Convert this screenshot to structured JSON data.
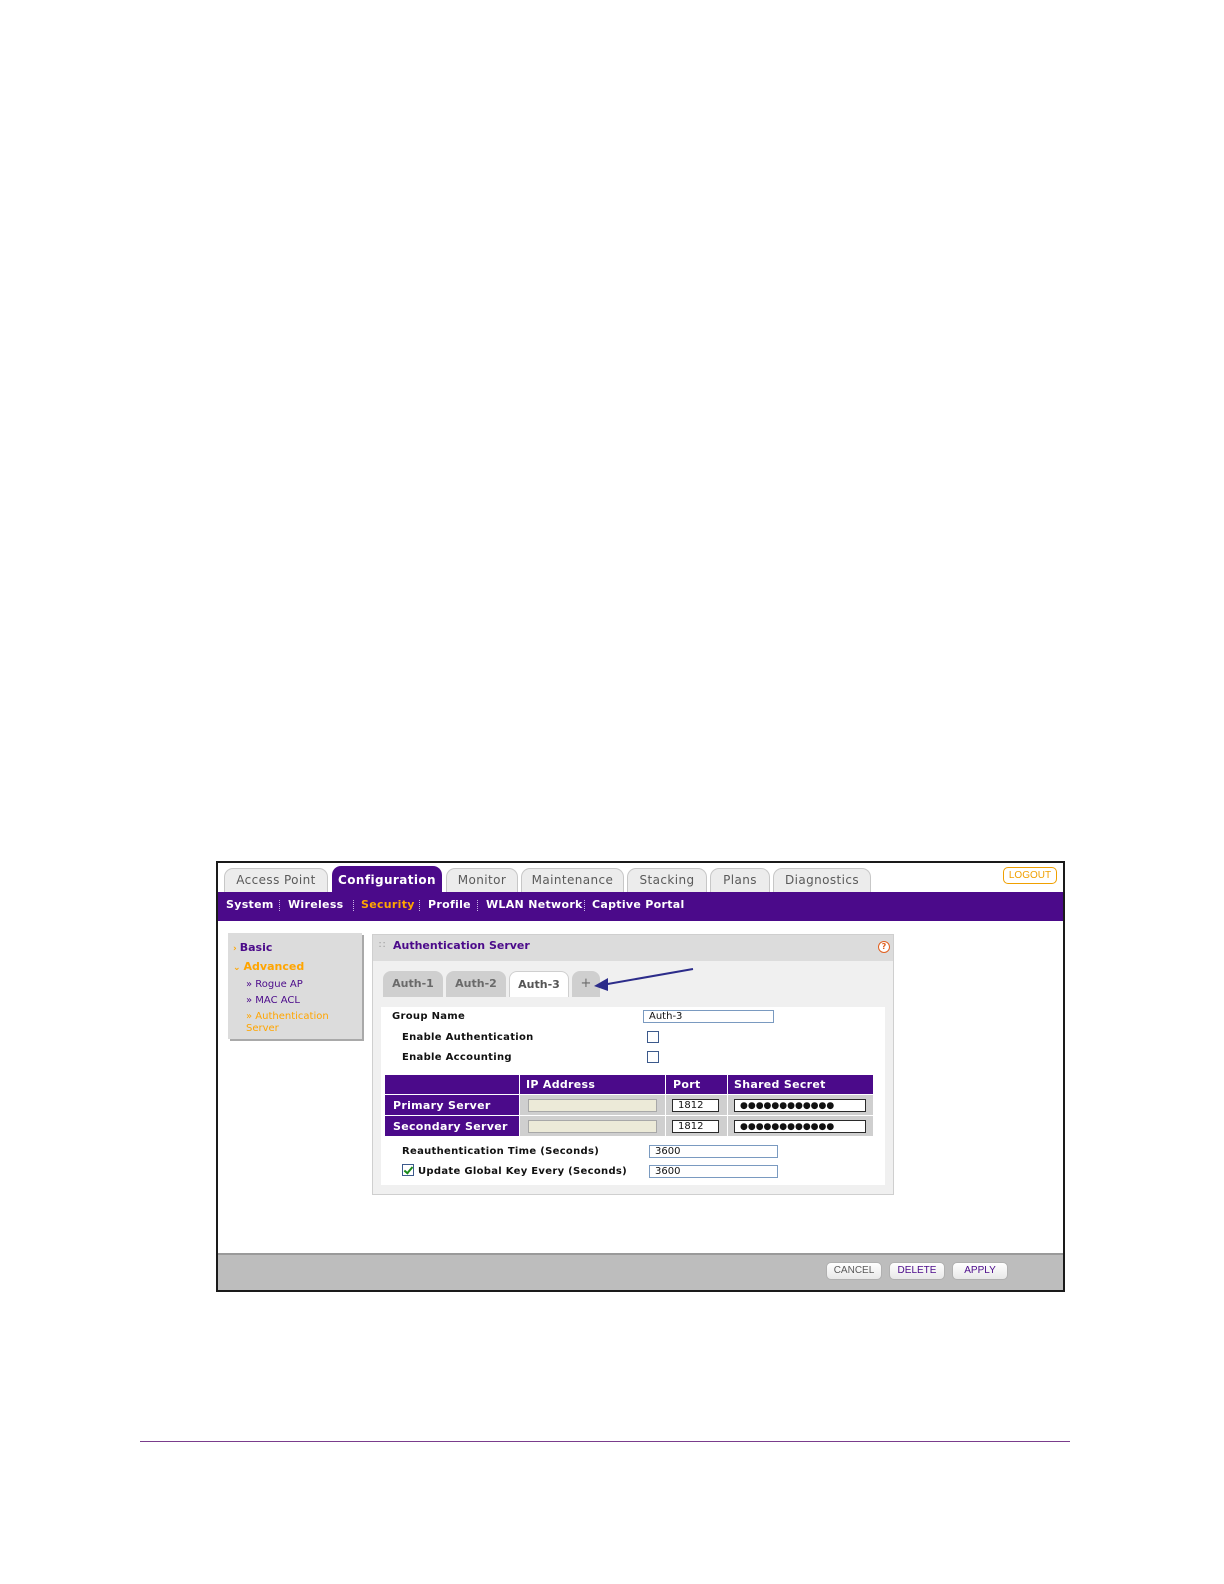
{
  "tabs": [
    {
      "label": "Access Point",
      "active": false
    },
    {
      "label": "Configuration",
      "active": true
    },
    {
      "label": "Monitor",
      "active": false
    },
    {
      "label": "Maintenance",
      "active": false
    },
    {
      "label": "Stacking",
      "active": false
    },
    {
      "label": "Plans",
      "active": false
    },
    {
      "label": "Diagnostics",
      "active": false
    }
  ],
  "logout_label": "LOGOUT",
  "subnav": [
    {
      "label": "System",
      "active": false
    },
    {
      "label": "Wireless",
      "active": false
    },
    {
      "label": "Security",
      "active": true
    },
    {
      "label": "Profile",
      "active": false
    },
    {
      "label": "WLAN Network",
      "active": false
    },
    {
      "label": "Captive Portal",
      "active": false
    }
  ],
  "leftmenu": {
    "basic": "Basic",
    "advanced": "Advanced",
    "items": [
      {
        "label": "» Rogue AP",
        "active": false
      },
      {
        "label": "» MAC ACL",
        "active": false
      },
      {
        "label": "» Authentication Server",
        "active": true
      }
    ]
  },
  "panel": {
    "title": "Authentication Server",
    "help_icon": "?",
    "tabs": [
      {
        "label": "Auth-1",
        "active": false
      },
      {
        "label": "Auth-2",
        "active": false
      },
      {
        "label": "Auth-3",
        "active": true
      },
      {
        "label": "+",
        "active": false
      }
    ]
  },
  "form": {
    "group_name_label": "Group Name",
    "group_name_value": "Auth-3",
    "enable_auth_label": "Enable Authentication",
    "enable_auth_checked": false,
    "enable_acct_label": "Enable Accounting",
    "enable_acct_checked": false,
    "table": {
      "headers": [
        "IP Address",
        "Port",
        "Shared Secret"
      ],
      "rows": [
        {
          "label": "Primary Server",
          "ip": "",
          "port": "1812",
          "secret": "●●●●●●●●●●●●"
        },
        {
          "label": "Secondary Server",
          "ip": "",
          "port": "1812",
          "secret": "●●●●●●●●●●●●"
        }
      ]
    },
    "reauth_label": "Reauthentication Time (Seconds)",
    "reauth_value": "3600",
    "update_key_label": "Update Global Key Every (Seconds)",
    "update_key_checked": true,
    "update_key_value": "3600"
  },
  "buttons": {
    "cancel": "CANCEL",
    "delete": "DELETE",
    "apply": "APPLY"
  },
  "colors": {
    "brand_purple": "#4b0a8a",
    "accent_orange": "#ffa500",
    "annotation_arrow": "#2c2c8a"
  }
}
